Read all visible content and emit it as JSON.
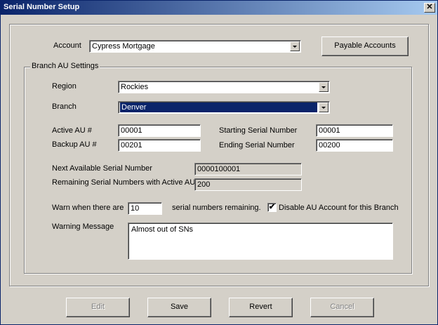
{
  "window": {
    "title": "Serial Number Setup",
    "close_glyph": "✕"
  },
  "account": {
    "label": "Account",
    "value": "Cypress Mortgage",
    "payable_button": "Payable Accounts"
  },
  "branch_settings": {
    "legend": "Branch AU Settings",
    "region_label": "Region",
    "region_value": "Rockies",
    "branch_label": "Branch",
    "branch_value": "Denver",
    "active_au_label": "Active AU #",
    "active_au_value": "00001",
    "backup_au_label": "Backup AU #",
    "backup_au_value": "00201",
    "starting_serial_label": "Starting Serial Number",
    "starting_serial_value": "00001",
    "ending_serial_label": "Ending Serial Number",
    "ending_serial_value": "00200",
    "next_available_label": "Next Available Serial Number",
    "next_available_value": "0000100001",
    "remaining_label": "Remaining Serial Numbers with Active AU",
    "remaining_value": "200",
    "warn_label": "Warn when there are",
    "warn_value": "10",
    "warn_suffix": "serial numbers remaining.",
    "disable_label": "Disable AU Account for this Branch",
    "disable_checked": true,
    "warning_message_label": "Warning Message",
    "warning_message_value": "Almost out of SNs"
  },
  "buttons": {
    "edit": "Edit",
    "save": "Save",
    "revert": "Revert",
    "cancel": "Cancel"
  }
}
